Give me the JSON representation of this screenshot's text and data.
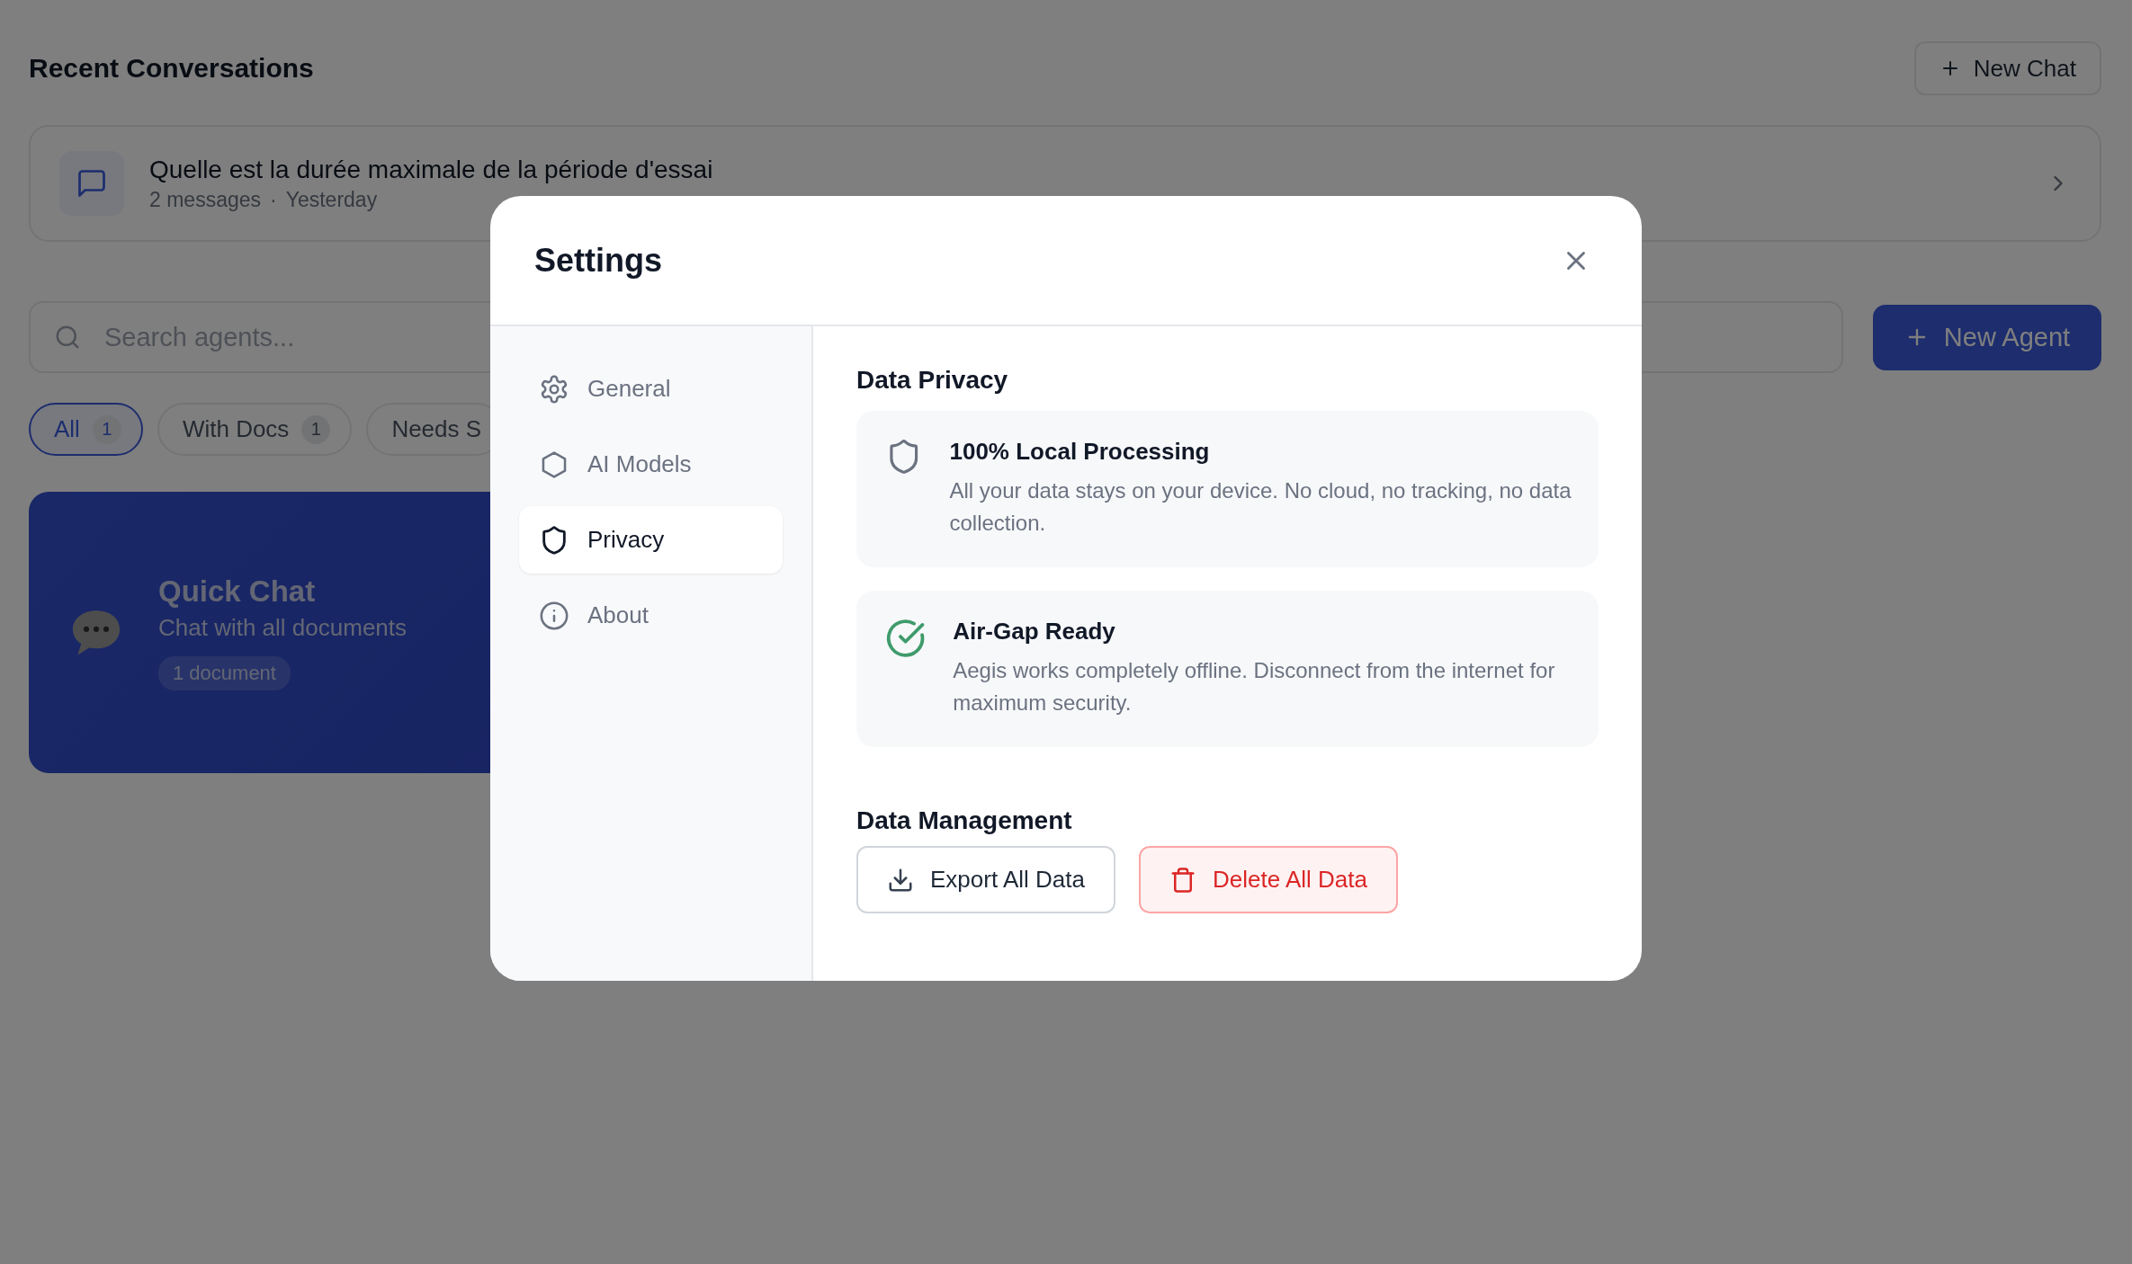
{
  "page": {
    "recent_title": "Recent Conversations",
    "new_chat_button": "New Chat",
    "conversations": [
      {
        "title": "Quelle est la durée maximale de la période d'essai",
        "messages": "2 messages",
        "separator": "·",
        "time": "Yesterday"
      }
    ],
    "search": {
      "placeholder": "Search agents..."
    },
    "new_agent_button": "New Agent",
    "filters": [
      {
        "label": "All",
        "count": "1",
        "selected": true
      },
      {
        "label": "With Docs",
        "count": "1",
        "selected": false
      },
      {
        "label": "Needs S",
        "selected": false
      }
    ],
    "agents": [
      {
        "name": "Quick Chat",
        "description": "Chat with all documents",
        "badge": "1 document"
      }
    ]
  },
  "settings_dialog": {
    "title": "Settings",
    "nav": [
      {
        "label": "General",
        "selected": false
      },
      {
        "label": "AI Models",
        "selected": false
      },
      {
        "label": "Privacy",
        "selected": true
      },
      {
        "label": "About",
        "selected": false
      }
    ],
    "privacy_title": "Data Privacy",
    "privacy_cards": [
      {
        "title": "100% Local Processing",
        "text": "All your data stays on your device. No cloud, no tracking, no data collection."
      },
      {
        "title": "Air-Gap Ready",
        "text": "Aegis works completely offline. Disconnect from the internet for maximum security."
      }
    ],
    "management_title": "Data Management",
    "actions": [
      {
        "label": "Export All Data",
        "kind": "default"
      },
      {
        "label": "Delete All Data",
        "kind": "danger"
      }
    ]
  }
}
